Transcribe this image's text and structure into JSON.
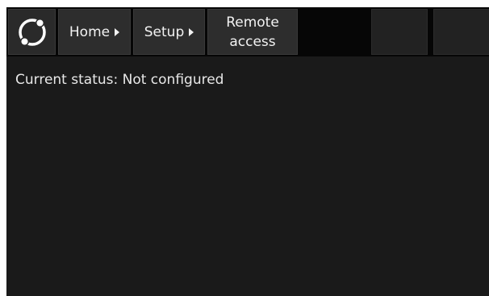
{
  "header": {
    "logo_icon": "ring-logo-icon",
    "breadcrumb": [
      {
        "label": "Home"
      },
      {
        "label": "Setup"
      }
    ],
    "current_line1": "Remote",
    "current_line2": "access"
  },
  "main": {
    "status_label": "Current status:",
    "status_value": "Not configured"
  },
  "colors": {
    "background": "#1a1a1a",
    "header_background": "#060606",
    "tile_background": "#2d2d2d",
    "text": "#f2f2f2"
  }
}
